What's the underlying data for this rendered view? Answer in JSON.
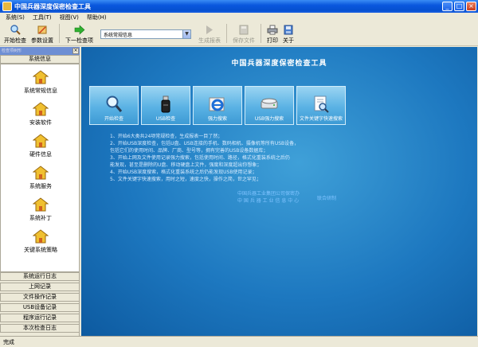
{
  "window": {
    "title": "中国兵器深度保密检查工具",
    "controls": [
      "_",
      "□",
      "×"
    ]
  },
  "menu": [
    {
      "label": "系统(S)"
    },
    {
      "label": "工具(T)"
    },
    {
      "label": "视图(V)"
    },
    {
      "label": "帮助(H)"
    }
  ],
  "toolbar": {
    "start_check": "开始检查",
    "param_settings": "参数设置",
    "next_item": "下一检查项",
    "combo_value": "系统常规信息",
    "gen_report": "生成报表",
    "save_file": "保存文件",
    "print": "打印",
    "about": "关于"
  },
  "sidebar": {
    "header": "检查项树形",
    "group_top": "系统信息",
    "items": [
      {
        "label": "系统常规信息"
      },
      {
        "label": "安装软件"
      },
      {
        "label": "硬件信息"
      },
      {
        "label": "系统服务"
      },
      {
        "label": "系统补丁"
      },
      {
        "label": "关键系统策略"
      }
    ],
    "groups_bottom": [
      {
        "label": "系统运行日志"
      },
      {
        "label": "上网记录"
      },
      {
        "label": "文件操作记录"
      },
      {
        "label": "USB设备记录"
      },
      {
        "label": "程序运行记录"
      },
      {
        "label": "本次检查日志"
      }
    ]
  },
  "main": {
    "title": "中国兵器深度保密检查工具",
    "features": [
      {
        "label": "开始检查"
      },
      {
        "label": "USB检查"
      },
      {
        "label": "强力搜索"
      },
      {
        "label": "USB强力搜索"
      },
      {
        "label": "文件关键字快速搜索"
      }
    ],
    "description": [
      "1、开始6大类共24项常规检查，生成报表一目了然；",
      "2、开始USB深度检查，包括U盘、USB连接的手机、数码相机、摄像机等所有USB设备，",
      "   包括它们的使用时间、品牌、厂商、型号等，拥有完善的USB设备数据库；",
      "3、开始上网及文件使用记录强力搜索，包括使用时间、路径，格式化重装系统之后仍",
      "   能发现，甚至是删除的U盘、移动硬盘上文件，强度和深度超出你想象；",
      "4、开始USB深度搜索，格式化重装系统之后仍能发现USB使用记录；",
      "5、文件关键字快速搜索，用时之短，速度之快，操作之简，世之罕见；"
    ],
    "org_line1": "中国兵器工业集团公司保密办",
    "org_line2": "中 国 兵 器 工 业 信 息 中 心",
    "org_tag": "联合研制"
  },
  "status": {
    "text": "完成"
  }
}
